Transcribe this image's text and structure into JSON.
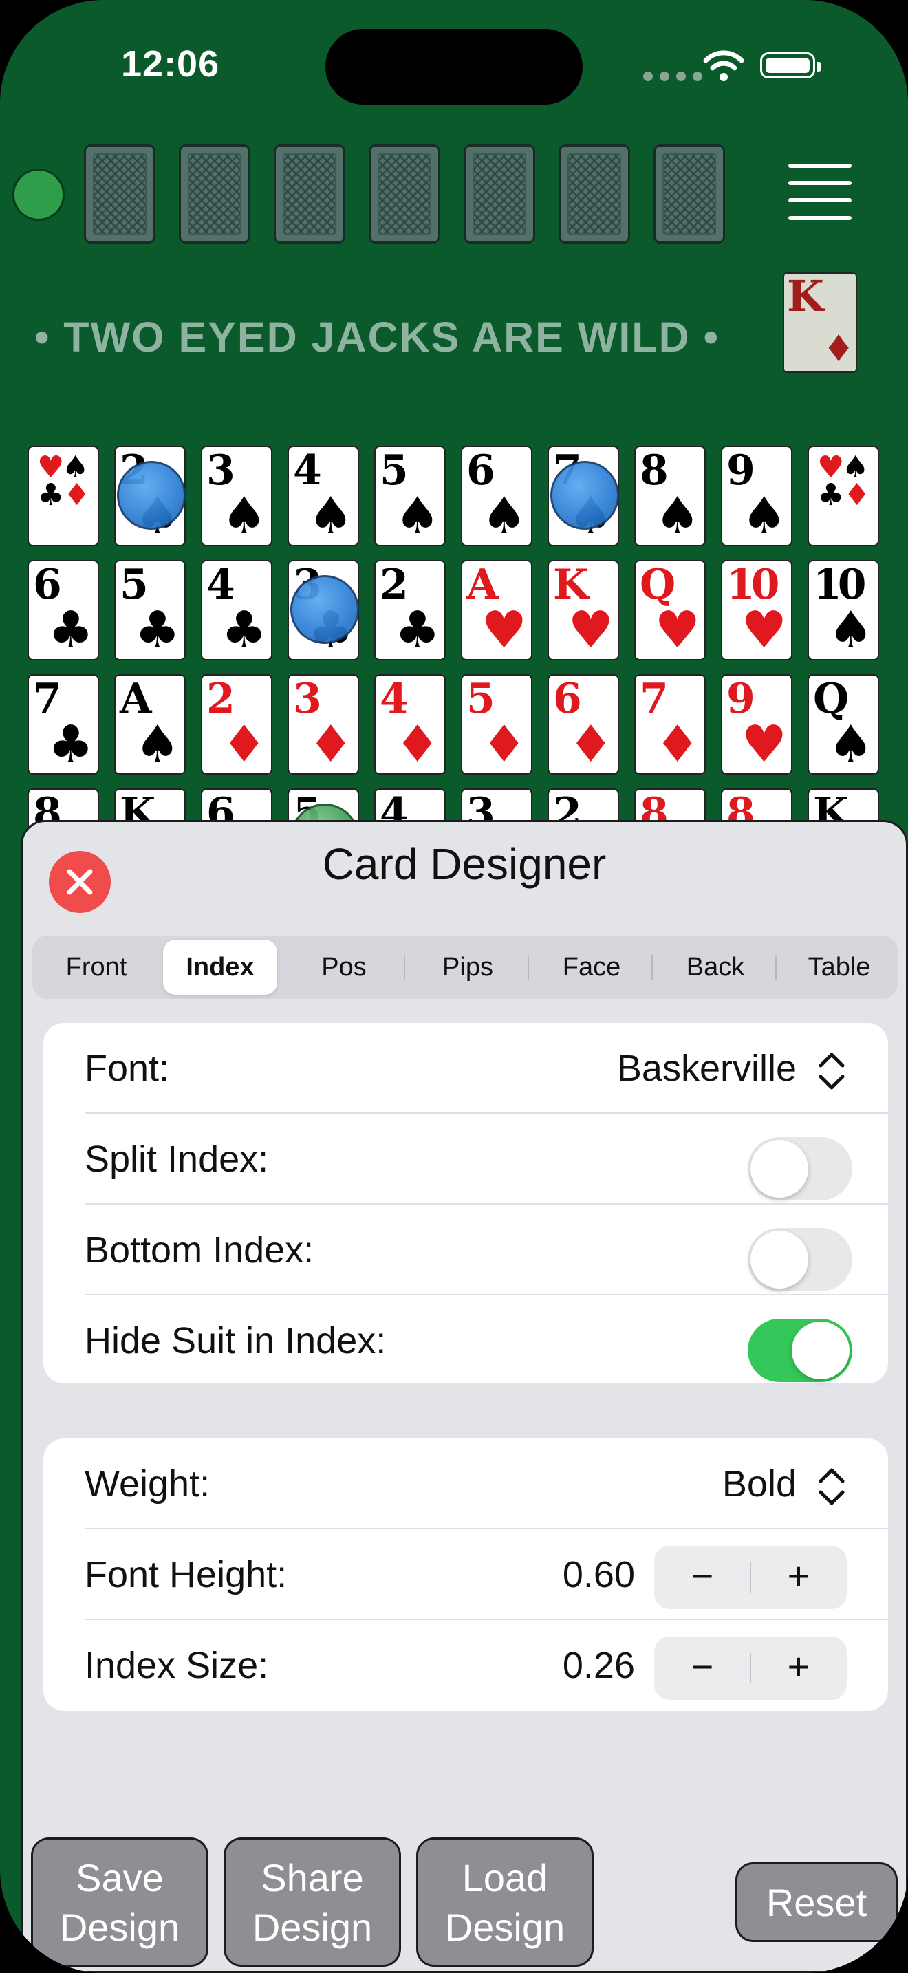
{
  "status": {
    "time": "12:06"
  },
  "game": {
    "banner": "• TWO EYED JACKS ARE WILD •",
    "top_card": {
      "rank": "K",
      "suit": "♦"
    },
    "rows": [
      [
        {
          "rank": "",
          "suit": "",
          "color": "red",
          "corner": true
        },
        {
          "rank": "2",
          "suit": "♠",
          "color": "black",
          "chip": "blue"
        },
        {
          "rank": "3",
          "suit": "♠",
          "color": "black"
        },
        {
          "rank": "4",
          "suit": "♠",
          "color": "black"
        },
        {
          "rank": "5",
          "suit": "♠",
          "color": "black"
        },
        {
          "rank": "6",
          "suit": "♠",
          "color": "black"
        },
        {
          "rank": "7",
          "suit": "♠",
          "color": "black",
          "chip": "blue"
        },
        {
          "rank": "8",
          "suit": "♠",
          "color": "black"
        },
        {
          "rank": "9",
          "suit": "♠",
          "color": "black"
        },
        {
          "rank": "",
          "suit": "",
          "color": "red",
          "corner": true
        }
      ],
      [
        {
          "rank": "6",
          "suit": "♣",
          "color": "black"
        },
        {
          "rank": "5",
          "suit": "♣",
          "color": "black"
        },
        {
          "rank": "4",
          "suit": "♣",
          "color": "black"
        },
        {
          "rank": "3",
          "suit": "♣",
          "color": "black",
          "chip": "blue"
        },
        {
          "rank": "2",
          "suit": "♣",
          "color": "black"
        },
        {
          "rank": "A",
          "suit": "♥",
          "color": "red"
        },
        {
          "rank": "K",
          "suit": "♥",
          "color": "red"
        },
        {
          "rank": "Q",
          "suit": "♥",
          "color": "red"
        },
        {
          "rank": "10",
          "suit": "♥",
          "color": "red"
        },
        {
          "rank": "10",
          "suit": "♠",
          "color": "black"
        }
      ],
      [
        {
          "rank": "7",
          "suit": "♣",
          "color": "black"
        },
        {
          "rank": "A",
          "suit": "♠",
          "color": "black"
        },
        {
          "rank": "2",
          "suit": "♦",
          "color": "red"
        },
        {
          "rank": "3",
          "suit": "♦",
          "color": "red"
        },
        {
          "rank": "4",
          "suit": "♦",
          "color": "red"
        },
        {
          "rank": "5",
          "suit": "♦",
          "color": "red"
        },
        {
          "rank": "6",
          "suit": "♦",
          "color": "red"
        },
        {
          "rank": "7",
          "suit": "♦",
          "color": "red"
        },
        {
          "rank": "9",
          "suit": "♥",
          "color": "red"
        },
        {
          "rank": "Q",
          "suit": "♠",
          "color": "black"
        }
      ],
      [
        {
          "rank": "8",
          "suit": "",
          "color": "black"
        },
        {
          "rank": "K",
          "suit": "",
          "color": "black"
        },
        {
          "rank": "6",
          "suit": "",
          "color": "black"
        },
        {
          "rank": "5",
          "suit": "",
          "color": "black",
          "chip": "green"
        },
        {
          "rank": "4",
          "suit": "",
          "color": "black"
        },
        {
          "rank": "3",
          "suit": "",
          "color": "black"
        },
        {
          "rank": "2",
          "suit": "",
          "color": "black"
        },
        {
          "rank": "8",
          "suit": "",
          "color": "red"
        },
        {
          "rank": "8",
          "suit": "",
          "color": "red"
        },
        {
          "rank": "K",
          "suit": "",
          "color": "black"
        }
      ]
    ]
  },
  "designer": {
    "title": "Card Designer",
    "tabs": [
      "Front",
      "Index",
      "Pos",
      "Pips",
      "Face",
      "Back",
      "Table"
    ],
    "active_tab": "Index",
    "font_label": "Font:",
    "font_value": "Baskerville",
    "split_label": "Split Index:",
    "split_on": false,
    "bottom_label": "Bottom Index:",
    "bottom_on": false,
    "hide_label": "Hide Suit in Index:",
    "hide_on": true,
    "weight_label": "Weight:",
    "weight_value": "Bold",
    "height_label": "Font Height:",
    "height_value": "0.60",
    "size_label": "Index Size:",
    "size_value": "0.26",
    "minus": "−",
    "plus": "+",
    "buttons": {
      "save": [
        "Save",
        "Design"
      ],
      "share": [
        "Share",
        "Design"
      ],
      "load": [
        "Load",
        "Design"
      ],
      "reset": "Reset"
    }
  },
  "colors": {
    "felt": "#0a5a2c",
    "toggle_on": "#34c759",
    "close": "#f04c4c",
    "red_suit": "#e0191e"
  }
}
